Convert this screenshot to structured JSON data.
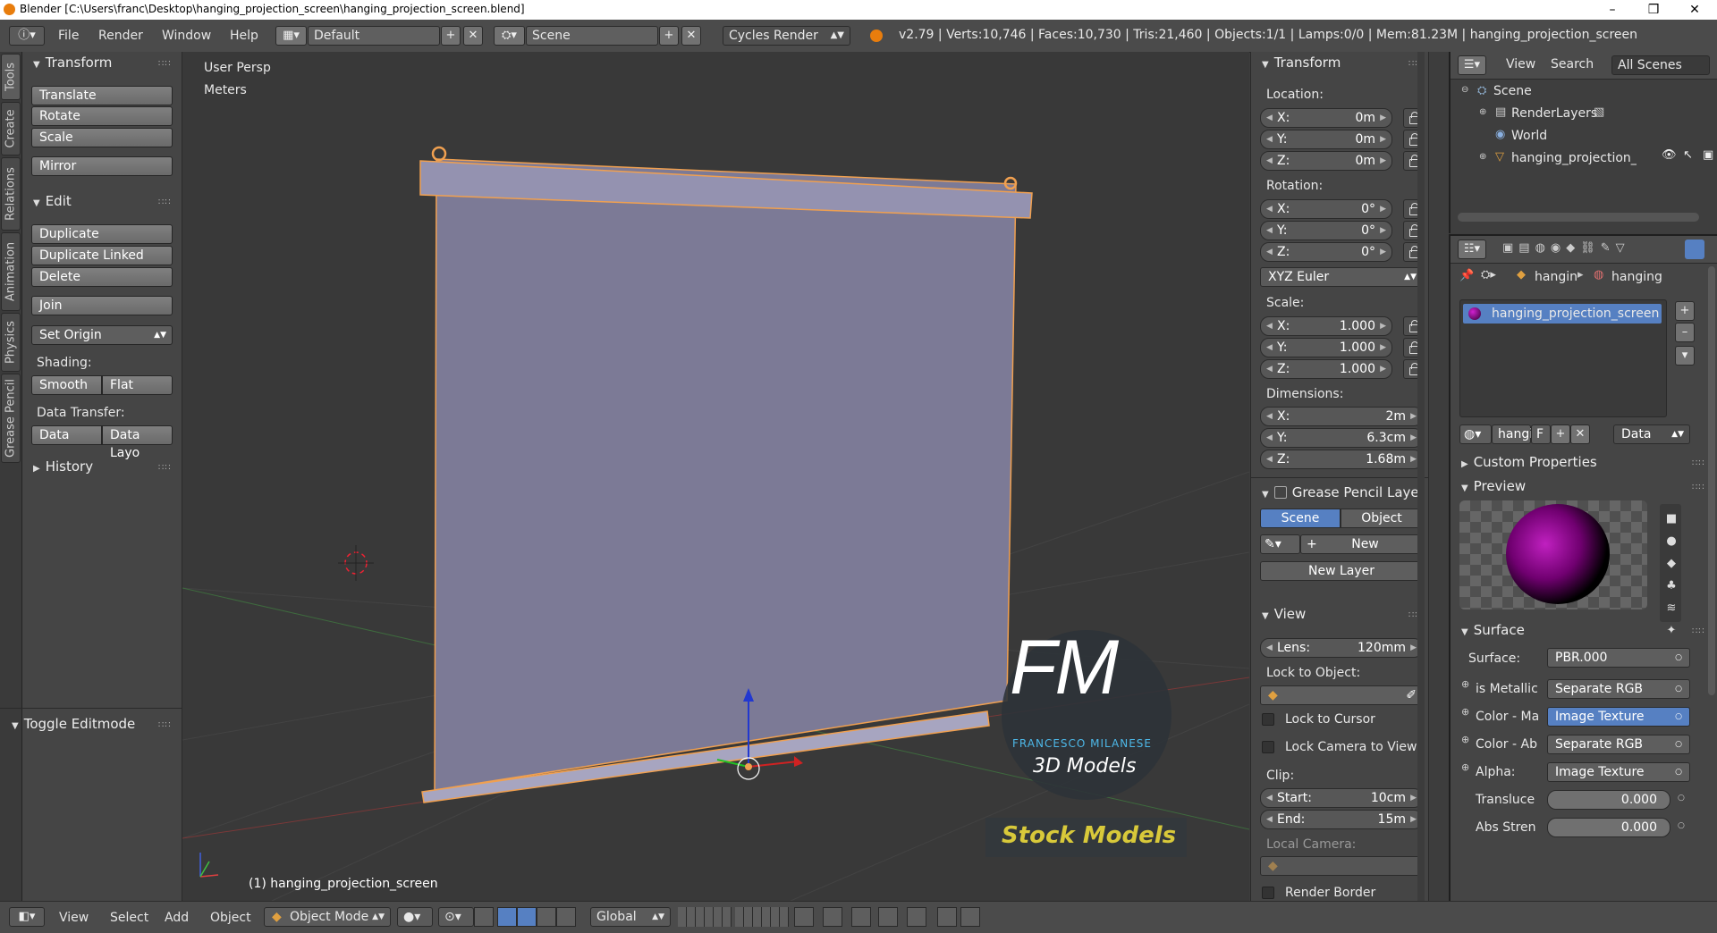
{
  "window": {
    "title": "Blender [C:\\Users\\franc\\Desktop\\hanging_projection_screen\\hanging_projection_screen.blend]",
    "controls": [
      "–",
      "❒",
      "✕"
    ]
  },
  "topbar": {
    "menus": [
      "File",
      "Render",
      "Window",
      "Help"
    ],
    "screen_layout": "Default",
    "scene": "Scene",
    "engine": "Cycles Render",
    "stats": "v2.79 | Verts:10,746 | Faces:10,730 | Tris:21,460 | Objects:1/1 | Lamps:0/0 | Mem:81.23M | hanging_projection_screen"
  },
  "left_tabs": [
    "Tools",
    "Create",
    "Relations",
    "Animation",
    "Physics",
    "Grease Pencil"
  ],
  "toolshelf": {
    "transform_header": "Transform",
    "transform_buttons": [
      "Translate",
      "Rotate",
      "Scale"
    ],
    "mirror": "Mirror",
    "edit_header": "Edit",
    "edit_buttons": [
      "Duplicate",
      "Duplicate Linked",
      "Delete"
    ],
    "join": "Join",
    "set_origin": "Set Origin",
    "shading_label": "Shading:",
    "smooth": "Smooth",
    "flat": "Flat",
    "data_transfer_label": "Data Transfer:",
    "data": "Data",
    "data_layout": "Data Layo",
    "history": "History",
    "toggle_editmode": "Toggle Editmode"
  },
  "viewport": {
    "view_name": "User Persp",
    "units": "Meters",
    "object_label": "(1) hanging_projection_screen",
    "watermark_logo": "FM",
    "watermark_name": "FRANCESCO MILANESE",
    "watermark_sub": "3D Models",
    "watermark_stock": "Stock Models"
  },
  "npanel": {
    "transform_header": "Transform",
    "location_label": "Location:",
    "location": {
      "x": "0m",
      "y": "0m",
      "z": "0m"
    },
    "rotation_label": "Rotation:",
    "rotation": {
      "x": "0°",
      "y": "0°",
      "z": "0°"
    },
    "rotation_mode": "XYZ Euler",
    "scale_label": "Scale:",
    "scale": {
      "x": "1.000",
      "y": "1.000",
      "z": "1.000"
    },
    "dimensions_label": "Dimensions:",
    "dimensions": {
      "x": "2m",
      "y": "6.3cm",
      "z": "1.68m"
    },
    "axis": {
      "x": "X:",
      "y": "Y:",
      "z": "Z:"
    },
    "gp_header": "Grease Pencil Layer",
    "gp_scene": "Scene",
    "gp_object": "Object",
    "gp_new": "New",
    "gp_new_layer": "New Layer",
    "view_header": "View",
    "lens_label": "Lens:",
    "lens": "120mm",
    "lock_to_object": "Lock to Object:",
    "lock_to_cursor": "Lock to Cursor",
    "lock_camera": "Lock Camera to View",
    "clip_label": "Clip:",
    "clip_start_label": "Start:",
    "clip_start": "10cm",
    "clip_end_label": "End:",
    "clip_end": "15m",
    "local_camera": "Local Camera:",
    "render_border": "Render Border"
  },
  "outliner": {
    "view": "View",
    "search": "Search",
    "filter": "All Scenes",
    "items": [
      "Scene",
      "RenderLayers",
      "World",
      "hanging_projection_scr"
    ]
  },
  "properties": {
    "breadcrumb_obj": "hangin",
    "breadcrumb_mat": "hanging",
    "material_slot": "hanging_projection_screen",
    "mat_name_short": "hangi",
    "fake_user": "F",
    "link": "Data",
    "custom_properties": "Custom Properties",
    "preview": "Preview",
    "surface_header": "Surface",
    "surface_label": "Surface:",
    "surface_value": "PBR.000",
    "rows": [
      {
        "label": "is Metallic",
        "value": "Separate RGB"
      },
      {
        "label": "Color - Ma",
        "value": "Image Texture"
      },
      {
        "label": "Color - Ab",
        "value": "Separate RGB"
      },
      {
        "label": "Alpha:",
        "value": "Image Texture"
      }
    ],
    "translucency_label": "Transluce",
    "translucency": "0.000",
    "abs_strength_label": "Abs Stren",
    "abs_strength": "0.000"
  },
  "bottombar": {
    "menus": [
      "View",
      "Select",
      "Add",
      "Object"
    ],
    "mode": "Object Mode",
    "orientation": "Global"
  },
  "colors": {
    "accent_blue": "#5680c2",
    "selection_orange": "#f0a050",
    "screen_fabric": "#7c7a96"
  }
}
